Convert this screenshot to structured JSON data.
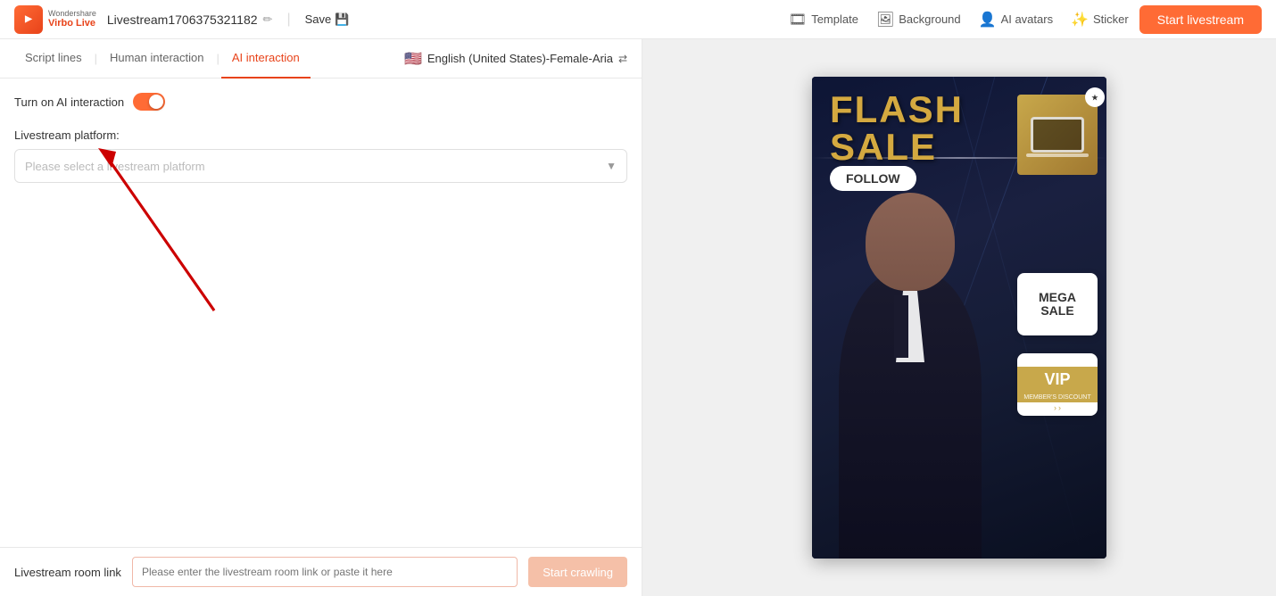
{
  "app": {
    "logo_line1": "Wondershare",
    "logo_line2": "Virbo Live",
    "title": "Livestream1706375321182",
    "save_label": "Save",
    "start_btn": "Start livestream"
  },
  "header_tools": [
    {
      "id": "template",
      "icon": "🎞",
      "label": "Template"
    },
    {
      "id": "background",
      "icon": "🖼",
      "label": "Background"
    },
    {
      "id": "ai-avatars",
      "icon": "👤",
      "label": "AI avatars"
    },
    {
      "id": "sticker",
      "icon": "✨",
      "label": "Sticker"
    }
  ],
  "tabs": {
    "items": [
      {
        "id": "script-lines",
        "label": "Script lines",
        "active": false
      },
      {
        "id": "human-interaction",
        "label": "Human interaction",
        "active": false
      },
      {
        "id": "ai-interaction",
        "label": "AI interaction",
        "active": true
      }
    ],
    "language": {
      "flag": "🇺🇸",
      "text": "English (United States)-Female-Aria"
    }
  },
  "content": {
    "toggle_label": "Turn on AI interaction",
    "toggle_on": true,
    "platform_label": "Livestream platform:",
    "platform_placeholder": "Please select a livestream platform"
  },
  "bottom_bar": {
    "label": "Livestream room link",
    "input_placeholder": "Please enter the livestream room link or paste it here",
    "crawl_btn": "Start crawling"
  },
  "preview": {
    "flash": "FLASH",
    "sale": "SALE",
    "follow": "FOLLOW",
    "mega": "MEGA",
    "sale2": "SALE",
    "vip": "VIP",
    "members_discount": "MEMBER'S DISCOUNT"
  }
}
